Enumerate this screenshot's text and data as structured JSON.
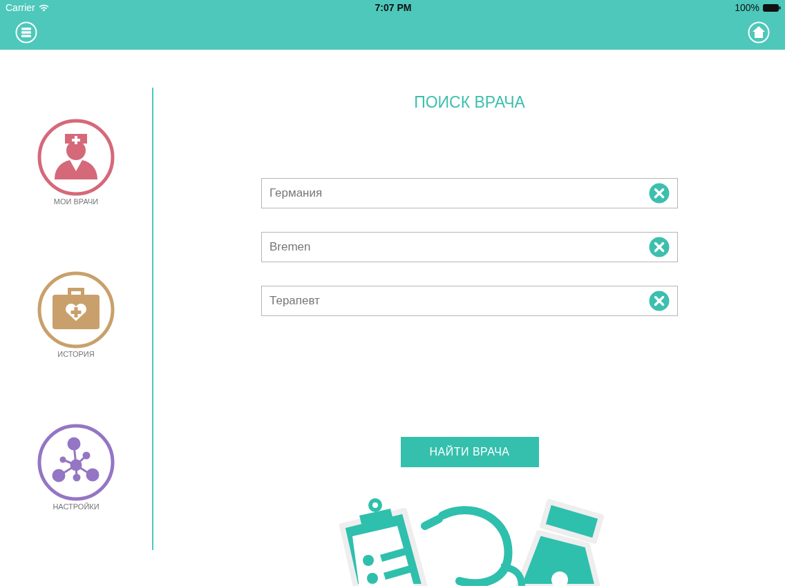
{
  "status_bar": {
    "carrier": "Carrier",
    "time": "7:07 PM",
    "battery": "100%"
  },
  "sidebar": {
    "items": [
      {
        "label": "МОИ ВРАЧИ",
        "kind": "doctor",
        "color": "#d5697a"
      },
      {
        "label": "ИСТОРИЯ",
        "kind": "kit",
        "color": "#c9a06b"
      },
      {
        "label": "НАСТРОЙКИ",
        "kind": "network",
        "color": "#9476c4"
      }
    ]
  },
  "title": "ПОИСК ВРАЧА",
  "fields": [
    {
      "value": "Германия"
    },
    {
      "value": "Bremen"
    },
    {
      "value": "Терапевт"
    }
  ],
  "search_button": "НАЙТИ ВРАЧА"
}
